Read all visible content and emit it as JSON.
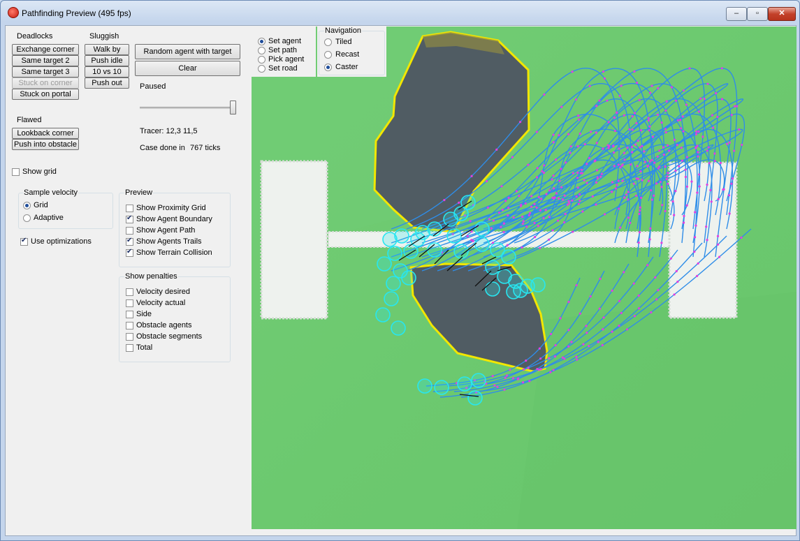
{
  "window": {
    "title": "Pathfinding Preview (495 fps)",
    "minimize": "–",
    "maximize": "▫",
    "close": "✕"
  },
  "left": {
    "deadlocks": {
      "label": "Deadlocks",
      "buttons": [
        "Exchange corner",
        "Same target 2",
        "Same target 3",
        "Stuck on corner",
        "Stuck on portal"
      ]
    },
    "sluggish": {
      "label": "Sluggish",
      "buttons": [
        "Walk by",
        "Push idle",
        "10 vs 10",
        "Push out"
      ]
    },
    "random_agent": "Random agent with target",
    "clear": "Clear",
    "paused": "Paused",
    "tracer": "Tracer: 12,3 11,5",
    "case_done_label": "Case done in",
    "case_done_value": "767 ticks",
    "flawed": {
      "label": "Flawed",
      "buttons": [
        "Lookback corner",
        "Push into obstacle"
      ]
    },
    "show_grid": "Show grid",
    "sample_velocity": {
      "label": "Sample velocity",
      "options": [
        "Grid",
        "Adaptive"
      ],
      "selected": "Grid"
    },
    "use_optimizations": "Use optimizations",
    "preview": {
      "label": "Preview",
      "items": [
        {
          "label": "Show Proximity Grid",
          "checked": false
        },
        {
          "label": "Show Agent Boundary",
          "checked": true
        },
        {
          "label": "Show Agent Path",
          "checked": false
        },
        {
          "label": "Show Agents Trails",
          "checked": true
        },
        {
          "label": "Show Terrain Collision",
          "checked": true
        }
      ]
    },
    "penalties": {
      "label": "Show penalties",
      "items": [
        "Velocity desired",
        "Velocity actual",
        "Side",
        "Obstacle agents",
        "Obstacle segments",
        "Total"
      ]
    }
  },
  "tools": {
    "modes": [
      "Set agent",
      "Set path",
      "Pick agent",
      "Set road"
    ],
    "selected_mode": "Set agent",
    "navigation": {
      "label": "Navigation",
      "options": [
        "Tiled",
        "Recast",
        "Caster"
      ],
      "selected": "Caster"
    }
  },
  "colors": {
    "ground": "#6fca72",
    "obstacle": "#505c63",
    "outline": "#f2e600",
    "trail": "#2f8de8",
    "agent": "#28e6f0",
    "marker": "#e040e0"
  }
}
